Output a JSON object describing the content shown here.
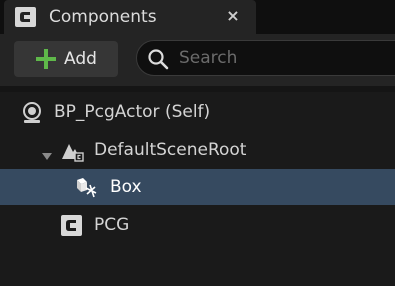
{
  "tab": {
    "title": "Components",
    "icon": "blueprint-c-icon",
    "close_glyph": "×"
  },
  "toolbar": {
    "add_label": "Add",
    "add_icon": "plus-icon",
    "search_placeholder": "Search"
  },
  "tree": {
    "items": [
      {
        "label": "BP_PcgActor (Self)",
        "icon": "actor-self-icon",
        "selected": false
      },
      {
        "label": "DefaultSceneRoot",
        "icon": "scene-root-icon",
        "expanded": true,
        "selected": false
      },
      {
        "label": "Box",
        "icon": "box-component-icon",
        "selected": true
      },
      {
        "label": "PCG",
        "icon": "pcg-component-icon",
        "selected": false
      }
    ]
  },
  "colors": {
    "accent_plus": "#5fb84a",
    "selection": "#364a60",
    "panel": "#242424",
    "background": "#151515"
  }
}
